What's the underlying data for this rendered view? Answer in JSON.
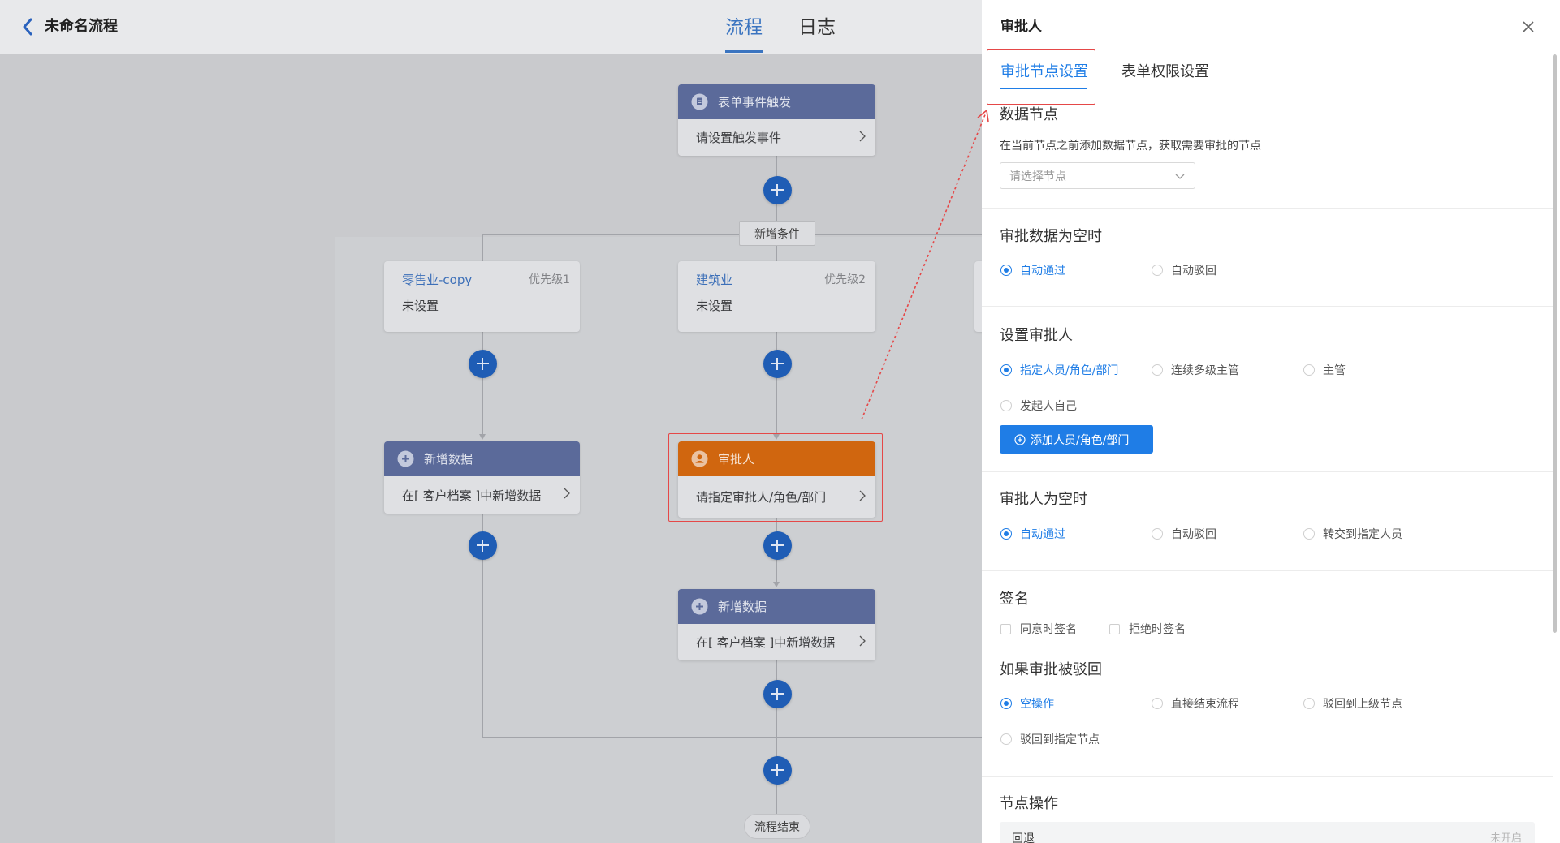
{
  "colors": {
    "accent": "#1f7de6",
    "highlight": "#e54848",
    "node_header": "#5b6a9a",
    "approver_header": "#d0660f",
    "plus": "#1f5db5"
  },
  "header": {
    "back_icon": "chevron-left-icon",
    "title": "未命名流程",
    "tabs": [
      {
        "label": "流程",
        "active": true
      },
      {
        "label": "日志",
        "active": false
      }
    ]
  },
  "flow": {
    "trigger": {
      "icon": "document-icon",
      "title": "表单事件触发",
      "body": "请设置触发事件"
    },
    "add_condition": "新增条件",
    "branches": [
      {
        "name": "零售业-copy",
        "priority": "优先级1",
        "status": "未设置"
      },
      {
        "name": "建筑业",
        "priority": "优先级2",
        "status": "未设置"
      }
    ],
    "left_node": {
      "icon": "plus-circle-icon",
      "title": "新增数据",
      "body": "在[ 客户档案 ]中新增数据"
    },
    "approver_node": {
      "icon": "user-icon",
      "title": "审批人",
      "body": "请指定审批人/角色/部门"
    },
    "center_node": {
      "icon": "plus-circle-icon",
      "title": "新增数据",
      "body": "在[ 客户档案 ]中新增数据"
    },
    "end": "流程结束"
  },
  "drawer": {
    "title": "审批人",
    "close_icon": "close-icon",
    "tabs": [
      {
        "label": "审批节点设置",
        "active": true
      },
      {
        "label": "表单权限设置",
        "active": false
      }
    ],
    "data_node": {
      "title": "数据节点",
      "description": "在当前节点之前添加数据节点，获取需要审批的节点",
      "select_placeholder": "请选择节点"
    },
    "empty_data": {
      "title": "审批数据为空时",
      "options": [
        {
          "label": "自动通过",
          "checked": true
        },
        {
          "label": "自动驳回",
          "checked": false
        }
      ]
    },
    "approver": {
      "title": "设置审批人",
      "options": [
        {
          "label": "指定人员/角色/部门",
          "checked": true
        },
        {
          "label": "连续多级主管",
          "checked": false
        },
        {
          "label": "主管",
          "checked": false
        },
        {
          "label": "发起人自己",
          "checked": false
        }
      ],
      "add_button": "添加人员/角色/部门"
    },
    "empty_approver": {
      "title": "审批人为空时",
      "options": [
        {
          "label": "自动通过",
          "checked": true
        },
        {
          "label": "自动驳回",
          "checked": false
        },
        {
          "label": "转交到指定人员",
          "checked": false
        }
      ]
    },
    "signature": {
      "title": "签名",
      "options": [
        {
          "label": "同意时签名",
          "checked": false
        },
        {
          "label": "拒绝时签名",
          "checked": false
        }
      ]
    },
    "rejected": {
      "title": "如果审批被驳回",
      "options": [
        {
          "label": "空操作",
          "checked": true
        },
        {
          "label": "直接结束流程",
          "checked": false
        },
        {
          "label": "驳回到上级节点",
          "checked": false
        },
        {
          "label": "驳回到指定节点",
          "checked": false
        }
      ]
    },
    "node_ops": {
      "title": "节点操作",
      "rows": [
        {
          "label": "回退",
          "status": "未开启"
        }
      ]
    }
  }
}
